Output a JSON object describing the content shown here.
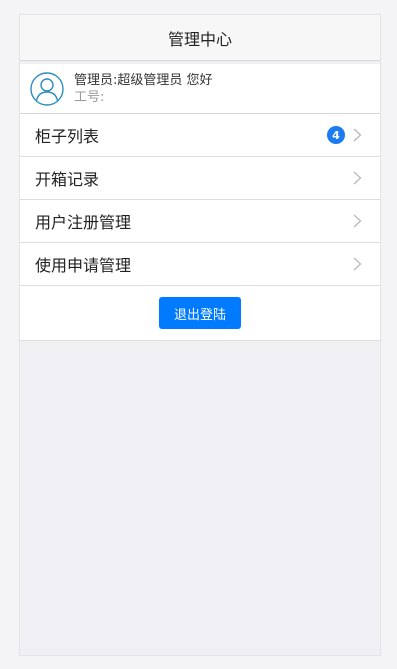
{
  "header": {
    "title": "管理中心"
  },
  "profile": {
    "avatar_icon": "user-avatar-icon",
    "greeting": "管理员:超级管理员 您好",
    "employee_id": "工号:"
  },
  "menu": {
    "items": [
      {
        "label": "柜子列表",
        "badge": "4",
        "icon": "chevron-right-icon"
      },
      {
        "label": "开箱记录",
        "icon": "chevron-right-icon"
      },
      {
        "label": "用户注册管理",
        "icon": "chevron-right-icon"
      },
      {
        "label": "使用申请管理",
        "icon": "chevron-right-icon"
      }
    ]
  },
  "logout": {
    "label": "退出登陆"
  },
  "colors": {
    "accent": "#007aff",
    "badge": "#1a7cf0",
    "avatar_stroke": "#2a8dbb"
  }
}
